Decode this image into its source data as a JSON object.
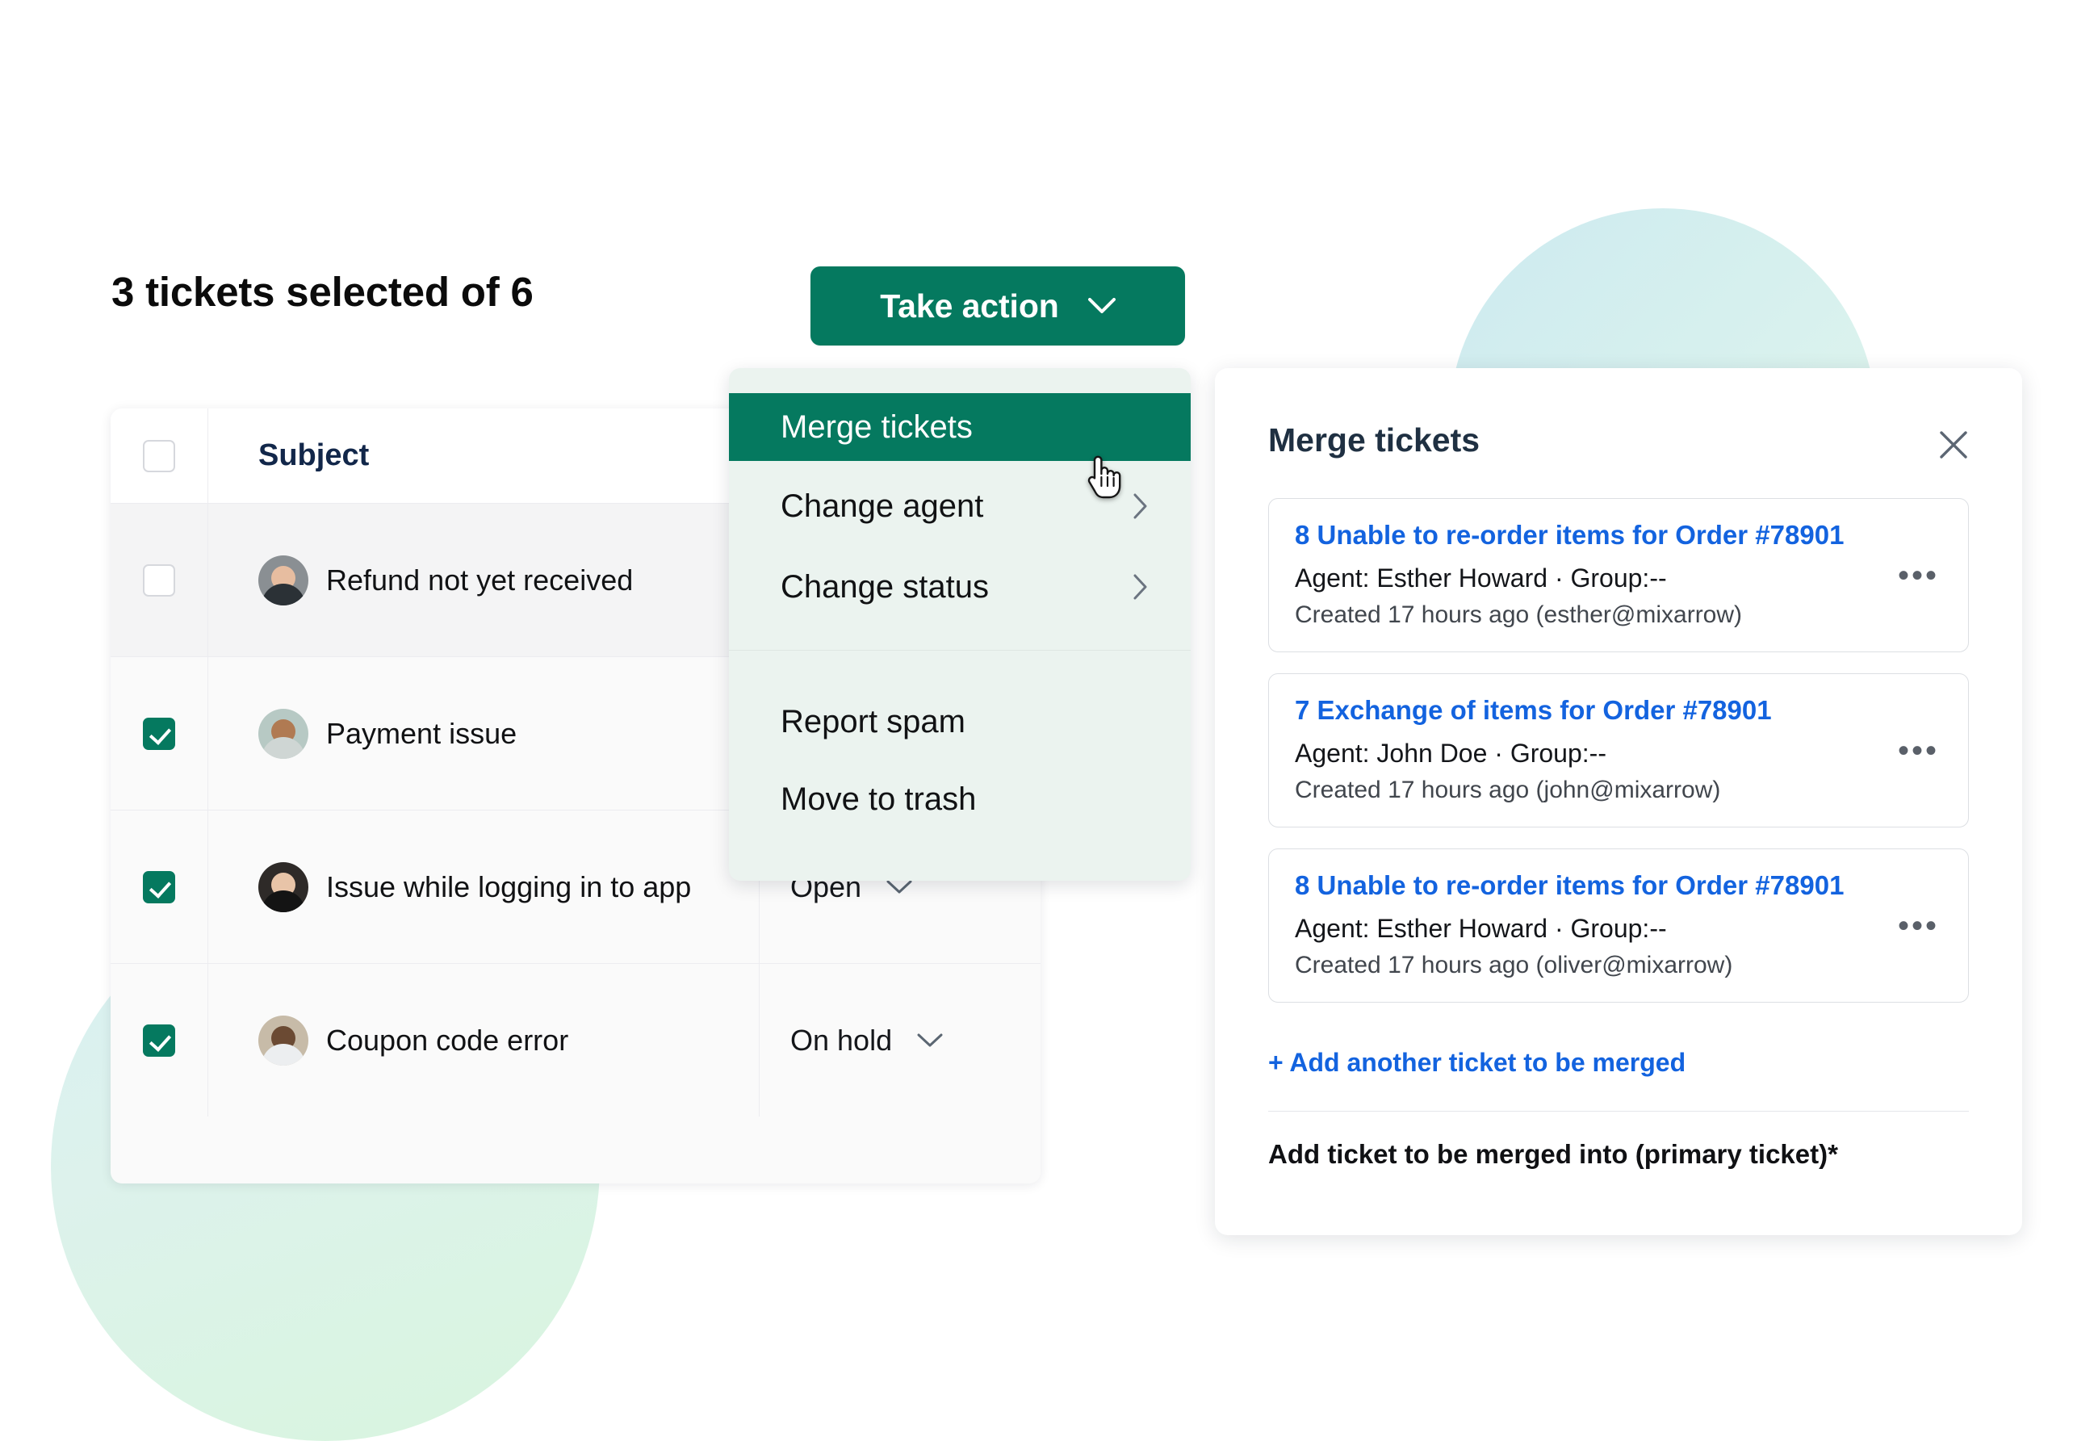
{
  "headline": "3 tickets selected of 6",
  "toolbar": {
    "take_action_label": "Take action",
    "chevron_icon": "chevron-down-icon"
  },
  "accent": {
    "green": "#05795f",
    "menu_bg": "#ebf3ef",
    "link_blue": "#1363df",
    "title_navy": "#1f3042"
  },
  "action_menu": {
    "items": [
      {
        "label": "Merge tickets",
        "active": true,
        "submenu": false
      },
      {
        "label": "Change agent",
        "active": false,
        "submenu": true
      },
      {
        "label": "Change status",
        "active": false,
        "submenu": true
      },
      {
        "label": "Report spam",
        "active": false,
        "submenu": false
      },
      {
        "label": "Move to trash",
        "active": false,
        "submenu": false
      }
    ]
  },
  "table": {
    "columns": [
      "",
      "Subject",
      ""
    ],
    "header_subject": "Subject",
    "rows": [
      {
        "checked": false,
        "subject": "Refund not yet received",
        "status": "",
        "hovered": true,
        "avatar": "avatar-man-glasses"
      },
      {
        "checked": true,
        "subject": "Payment issue",
        "status": "",
        "hovered": false,
        "avatar": "avatar-woman-curly"
      },
      {
        "checked": true,
        "subject": "Issue while logging in to app",
        "status": "Open",
        "hovered": false,
        "avatar": "avatar-woman-blonde"
      },
      {
        "checked": true,
        "subject": "Coupon code error",
        "status": "On hold",
        "hovered": false,
        "avatar": "avatar-man-polo"
      }
    ]
  },
  "merge_panel": {
    "title": "Merge tickets",
    "close_icon": "close-icon",
    "tickets": [
      {
        "title": "8 Unable to re-order items for Order #78901",
        "agent": "Agent: Esther Howard · Group:--",
        "created": "Created 17 hours ago (esther@mixarrow)",
        "more_icon": "more-options-icon"
      },
      {
        "title": "7 Exchange of items for Order #78901",
        "agent": "Agent: John Doe  · Group:--",
        "created": "Created 17 hours ago (john@mixarrow)",
        "more_icon": "more-options-icon"
      },
      {
        "title": "8 Unable to re-order items for Order #78901",
        "agent": "Agent: Esther Howard · Group:--",
        "created": "Created 17 hours ago (oliver@mixarrow)",
        "more_icon": "more-options-icon"
      }
    ],
    "add_another_label": "+ Add another ticket to be merged",
    "primary_label": "Add ticket to be merged into (primary ticket)*"
  }
}
